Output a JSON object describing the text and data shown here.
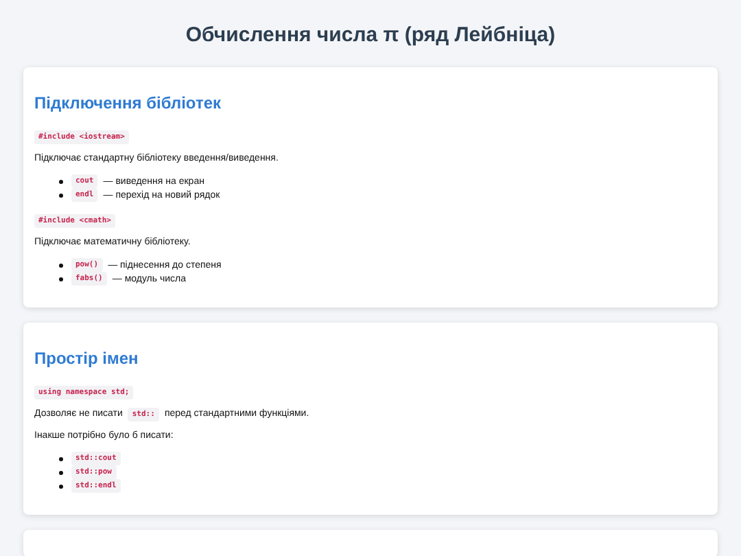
{
  "title": "Обчислення числа π (ряд Лейбніца)",
  "sections": [
    {
      "heading": "Підключення бібліотек",
      "blocks": [
        {
          "kind": "code",
          "text": "#include <iostream>"
        },
        {
          "kind": "para",
          "parts": [
            {
              "kind": "text",
              "text": "Підключає стандартну бібліотеку введення/виведення."
            }
          ]
        },
        {
          "kind": "list",
          "items": [
            {
              "code": "cout",
              "text": "— виведення на екран"
            },
            {
              "code": "endl",
              "text": "— перехід на новий рядок"
            }
          ]
        },
        {
          "kind": "code",
          "text": "#include <cmath>"
        },
        {
          "kind": "para",
          "parts": [
            {
              "kind": "text",
              "text": "Підключає математичну бібліотеку."
            }
          ]
        },
        {
          "kind": "list",
          "items": [
            {
              "code": "pow()",
              "text": "— піднесення до степеня"
            },
            {
              "code": "fabs()",
              "text": "— модуль числа"
            }
          ]
        }
      ]
    },
    {
      "heading": "Простір імен",
      "blocks": [
        {
          "kind": "code",
          "text": "using namespace std;"
        },
        {
          "kind": "para",
          "parts": [
            {
              "kind": "text",
              "text": "Дозволяє не писати"
            },
            {
              "kind": "code",
              "text": "std::"
            },
            {
              "kind": "text",
              "text": "перед стандартними функціями."
            }
          ]
        },
        {
          "kind": "para",
          "parts": [
            {
              "kind": "text",
              "text": "Інакше потрібно було б писати:"
            }
          ]
        },
        {
          "kind": "list",
          "items": [
            {
              "code": "std::cout"
            },
            {
              "code": "std::pow"
            },
            {
              "code": "std::endl"
            }
          ]
        }
      ]
    }
  ]
}
